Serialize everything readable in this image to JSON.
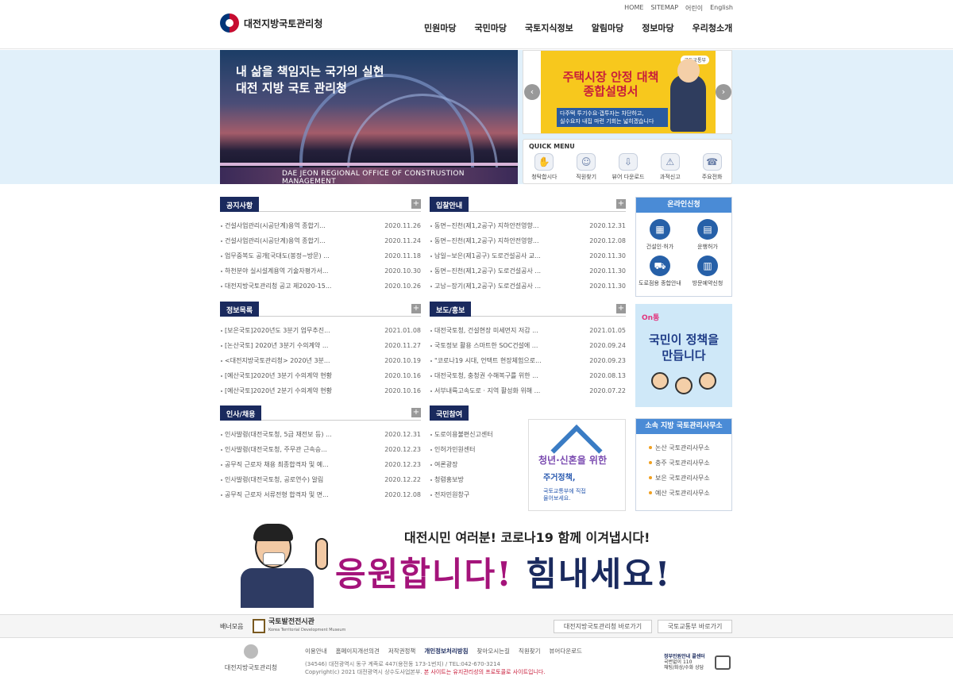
{
  "util_links": [
    "HOME",
    "SITEMAP",
    "어린이",
    "English"
  ],
  "logo_text": "대전지방국토관리청",
  "gnb": [
    "민원마당",
    "국민마당",
    "국토지식정보",
    "알림마당",
    "정보마당",
    "우리청소개"
  ],
  "hero": {
    "title_line1": "내 삶을 책임지는 국가의 실현",
    "title_line2": "대전 지방 국토 관리청",
    "caption": "DAE JEON REGIONAL OFFICE OF CONSTRUSTION MANAGEMENT"
  },
  "policy_banner": {
    "badge": "국토교통부",
    "title_line1": "주택시장 안정 대책",
    "title_line2": "종합설명서",
    "sub_line1": "다주택 투기수요·갭투자는 차단하고,",
    "sub_line2": "실수요자 내집 마련 기회는 넓히겠습니다",
    "prev": "‹",
    "next": "›"
  },
  "quick_menu": {
    "title": "QUICK MENU",
    "items": [
      {
        "label": "청탁합시다",
        "icon": "handshake-icon",
        "glyph": "✋"
      },
      {
        "label": "직원찾기",
        "icon": "people-icon",
        "glyph": "☺"
      },
      {
        "label": "뷰어 다운로드",
        "icon": "download-icon",
        "glyph": "⇩"
      },
      {
        "label": "과적신고",
        "icon": "truck-icon",
        "glyph": "⚠"
      },
      {
        "label": "주요전화",
        "icon": "phone-icon",
        "glyph": "☎"
      }
    ]
  },
  "boards": {
    "notice": {
      "title": "공지사항",
      "rows": [
        {
          "t": "건설사업관리(시공단계)용역 종합기...",
          "d": "2020.11.26"
        },
        {
          "t": "건설사업관리(시공단계)용역 종합기...",
          "d": "2020.11.24"
        },
        {
          "t": "업무중복도 공개[국대도(봉정~방문) ...",
          "d": "2020.11.18"
        },
        {
          "t": "하천분야 실시설계용역 기술자평가서...",
          "d": "2020.10.30"
        },
        {
          "t": "대전지방국토관리청 공고 제2020-15...",
          "d": "2020.10.26"
        }
      ]
    },
    "bid": {
      "title": "입찰안내",
      "rows": [
        {
          "t": "동면~진천(제1,2공구) 지하안전영향...",
          "d": "2020.12.31"
        },
        {
          "t": "동면~진천(제1,2공구) 지하안전영향...",
          "d": "2020.12.08"
        },
        {
          "t": "남일~보은(제1공구) 도로건설공사 교...",
          "d": "2020.11.30"
        },
        {
          "t": "동면~진천(제1,2공구) 도로건설공사 ...",
          "d": "2020.11.30"
        },
        {
          "t": "고남~장기(제1,2공구) 도로건설공사 ...",
          "d": "2020.11.30"
        }
      ]
    },
    "info": {
      "title": "정보목록",
      "rows": [
        {
          "t": "[보은국토]2020년도 3분기 업무추진...",
          "d": "2021.01.08"
        },
        {
          "t": "[논산국토] 2020년 3분기 수의계약 ...",
          "d": "2020.11.27"
        },
        {
          "t": "<대전지방국토관리청> 2020년 3분...",
          "d": "2020.10.19"
        },
        {
          "t": "[예산국토]2020년 3분기 수의계약 현황",
          "d": "2020.10.16"
        },
        {
          "t": "[예산국토]2020년 2분기 수의계약 현황",
          "d": "2020.10.16"
        }
      ]
    },
    "press": {
      "title": "보도/홍보",
      "rows": [
        {
          "t": "대전국토청, 건설현장 미세먼지 저감 ...",
          "d": "2021.01.05"
        },
        {
          "t": "국토정보 활용 스마트한 SOC건설에 ...",
          "d": "2020.09.24"
        },
        {
          "t": "\"코로나19 시대, 언택트 현장체험으로...",
          "d": "2020.09.23"
        },
        {
          "t": "대전국토청, 충청권 수해복구를 위한 ...",
          "d": "2020.08.13"
        },
        {
          "t": "서부내륙고속도로 · 지역 활성화 위해 ...",
          "d": "2020.07.22"
        }
      ]
    },
    "hr": {
      "title": "인사/채용",
      "rows": [
        {
          "t": "인사발령(대전국토청, 5급 재전보 등) ...",
          "d": "2020.12.31"
        },
        {
          "t": "인사발령(대전국토청, 주무관 근속승...",
          "d": "2020.12.23"
        },
        {
          "t": "공무직 근로자 채용 최종합격자 및 예...",
          "d": "2020.12.23"
        },
        {
          "t": "인사발령(대전국토청, 공로연수) 알림",
          "d": "2020.12.22"
        },
        {
          "t": "공무직 근로자 서류전형 합격자 및 면...",
          "d": "2020.12.08"
        }
      ]
    },
    "participation": {
      "title": "국민참여",
      "items": [
        "도로이용불편신고센터",
        "인허가민원센터",
        "여론광장",
        "청렴홍보방",
        "전자민원창구"
      ]
    }
  },
  "housing_banner": {
    "line1": "청년·신혼을 위한",
    "line2": "주거정책,",
    "line3": "국토교통부에 직접",
    "line4": "물어보세요."
  },
  "online": {
    "title": "온라인신청",
    "items": [
      {
        "label": "건설인·허가",
        "icon": "building-icon",
        "glyph": "▦"
      },
      {
        "label": "운행허가",
        "icon": "document-icon",
        "glyph": "▤"
      },
      {
        "label": "도로점용 종합안내",
        "icon": "road-icon",
        "glyph": "⛟"
      },
      {
        "label": "방문예약신청",
        "icon": "calendar-icon",
        "glyph": "▥"
      }
    ]
  },
  "onpolicy": {
    "logo": "On통",
    "line1": "국민이 정책을",
    "line2": "만듭니다"
  },
  "offices": {
    "title": "소속 지방 국토관리사무소",
    "items": [
      "논산 국토관리사무소",
      "충주 국토관리사무소",
      "보은 국토관리사무소",
      "예산 국토관리사무소"
    ]
  },
  "covid": {
    "line1": "대전시민 여러분! 코로나19 함께 이겨냅시다!",
    "line2a": "응원합니다!",
    "line2b": " 힘내세요!"
  },
  "banner_bar": {
    "label": "배너모음",
    "logo_main": "국토발전전시관",
    "logo_sub": "Korea Territorial Development Museum",
    "link1": "대전지방국토관리청 바로가기",
    "link2": "국토교통부 바로가기"
  },
  "footer": {
    "logo_text": "대전지방국토관리청",
    "nav": [
      "이용안내",
      "홈페이지개선의견",
      "저작권정책",
      "개인정보처리방침",
      "찾아오시는길",
      "직원찾기",
      "뷰어다운로드"
    ],
    "address": "(34546) 대전광역시 동구 계족로 447(용전동 173-1번지) / TEL:042-670-3214",
    "copyright": "Copyright(c) 2021 대전광역시 상수도사업본부.",
    "copyright_red": "본 사이트는 유지관리성의 프로토콜로 사이트입니다.",
    "badge_line1": "정부민원안내 콜센터",
    "badge_line2": "국번없이 110",
    "badge_line3": "채팅/화상/수화 상담"
  }
}
